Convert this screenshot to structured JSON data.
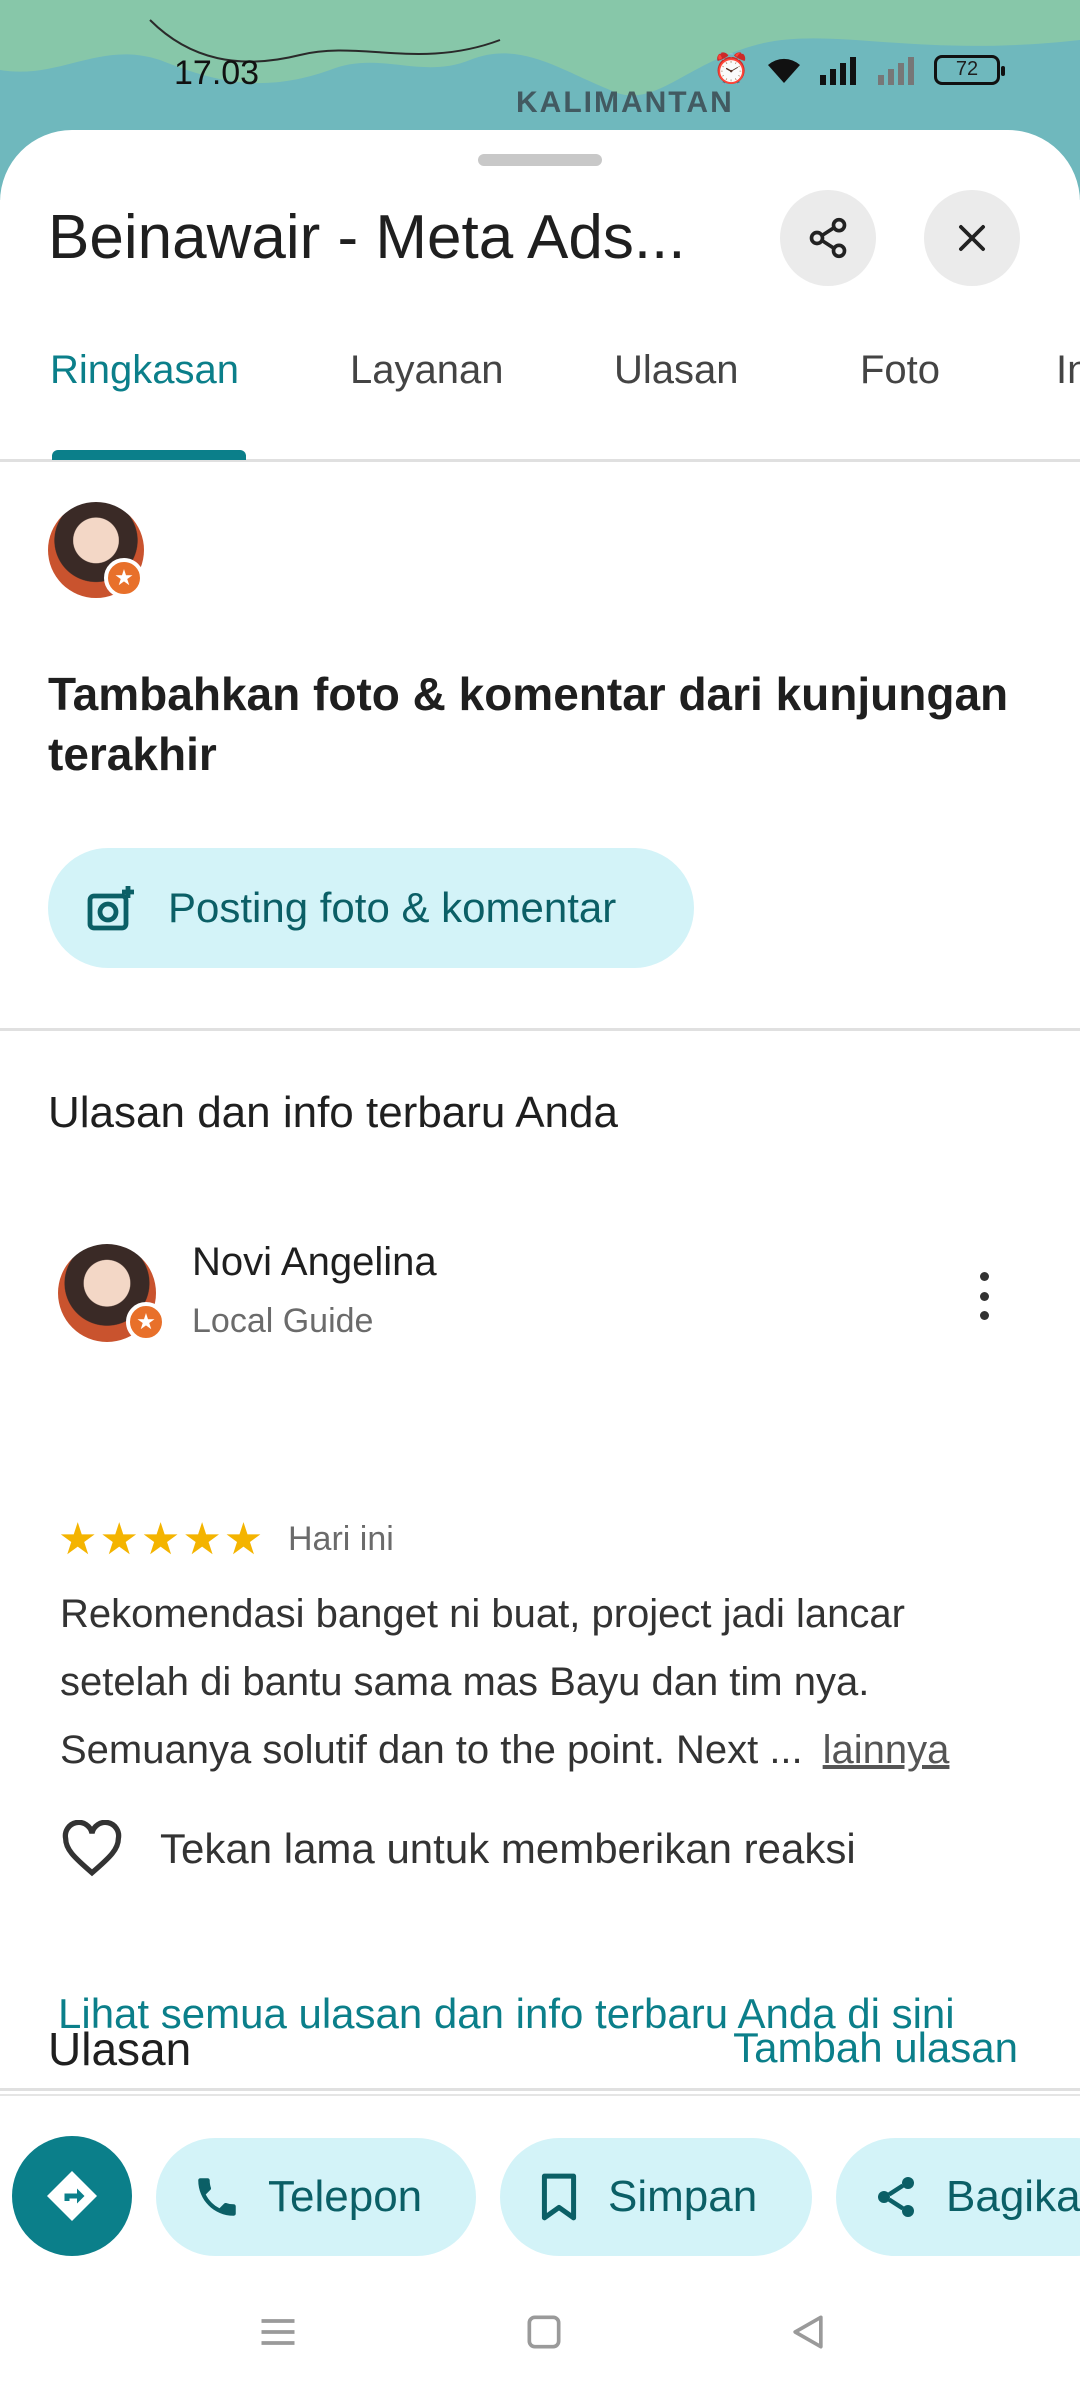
{
  "status_bar": {
    "time": "17.03",
    "battery": "72"
  },
  "map": {
    "label": "KALIMANTAN"
  },
  "sheet": {
    "title": "Beinawair - Meta Ads...",
    "share_icon": "share-icon",
    "close_icon": "close-icon"
  },
  "tabs": [
    {
      "label": "Ringkasan",
      "active": true
    },
    {
      "label": "Layanan"
    },
    {
      "label": "Ulasan"
    },
    {
      "label": "Foto"
    },
    {
      "label": "In"
    }
  ],
  "add_photo": {
    "prompt": "Tambahkan foto & komentar dari kunjungan terakhir",
    "button_label": "Posting foto & komentar"
  },
  "your_reviews": {
    "title": "Ulasan dan info terbaru Anda",
    "reviewer": {
      "name": "Novi Angelina",
      "subtitle": "Local Guide"
    },
    "rating": 5,
    "stars": "★★★★★",
    "date": "Hari ini",
    "text": "Rekomendasi banget ni buat, project jadi lancar setelah di bantu sama mas Bayu dan tim nya. Semuanya solutif dan to the point. Next ...",
    "more_label": "lainnya",
    "reaction_hint": "Tekan lama untuk memberikan reaksi",
    "see_all": "Lihat semua ulasan dan info terbaru Anda di sini"
  },
  "reviews_section": {
    "title": "Ulasan",
    "add_label": "Tambah ulasan"
  },
  "actions": [
    {
      "label": "Telepon",
      "icon": "phone-icon"
    },
    {
      "label": "Simpan",
      "icon": "bookmark-icon"
    },
    {
      "label": "Bagikan",
      "icon": "share-icon"
    }
  ],
  "colors": {
    "accent": "#0b7f8a",
    "pill_bg": "#d3f3f8",
    "map": "#6fb8bd",
    "star": "#f4b400",
    "badge": "#e8702a"
  }
}
